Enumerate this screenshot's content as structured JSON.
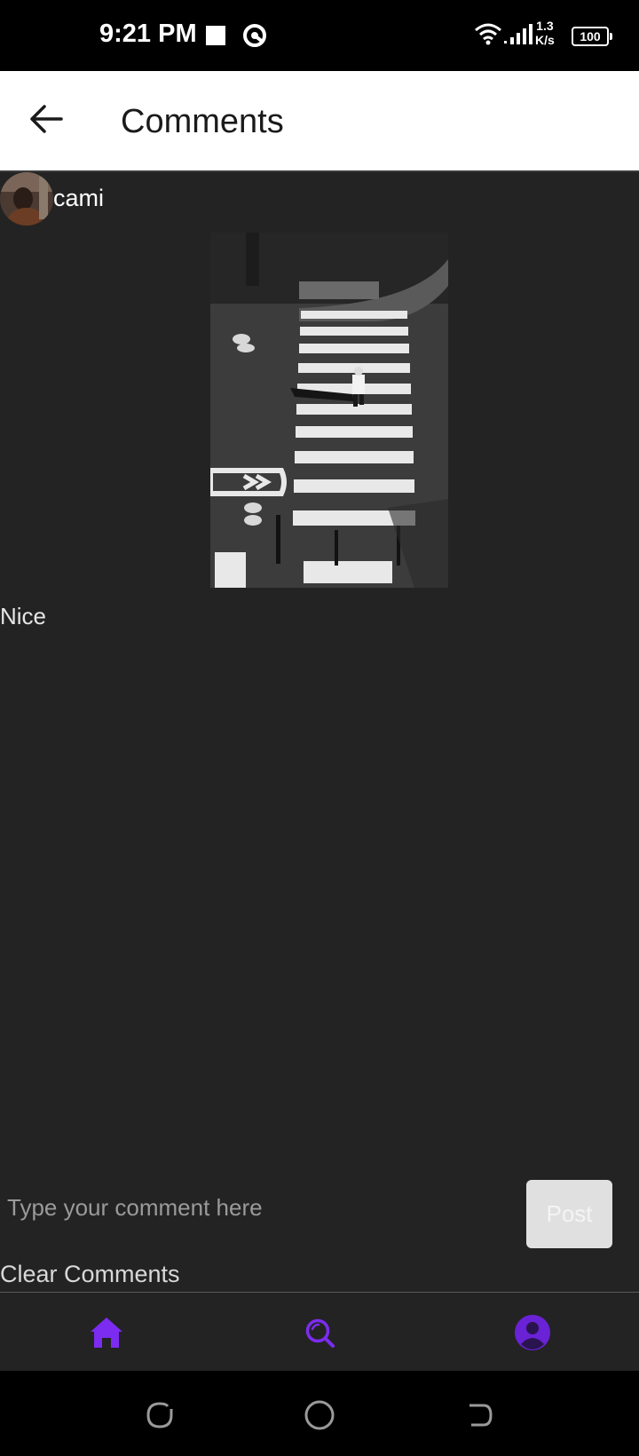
{
  "status_bar": {
    "time": "9:21 PM",
    "net_speed_value": "1.3",
    "net_speed_unit": "K/s",
    "battery": "100"
  },
  "app_bar": {
    "title": "Comments",
    "back_icon": "arrow-left-icon"
  },
  "post": {
    "username": "cami",
    "image_description_icon": "photo",
    "comments": [
      {
        "text": "Nice"
      }
    ]
  },
  "composer": {
    "placeholder": "Type your comment here",
    "post_label": "Post",
    "clear_label": "Clear Comments"
  },
  "bottom_nav": {
    "items": [
      {
        "icon": "home-icon",
        "active": true
      },
      {
        "icon": "search-icon",
        "active": false
      },
      {
        "icon": "profile-icon",
        "active": false
      }
    ],
    "accent": "#7b2cf0"
  },
  "colors": {
    "background": "#232323",
    "app_bar": "#ffffff",
    "accent": "#7b2cf0"
  }
}
